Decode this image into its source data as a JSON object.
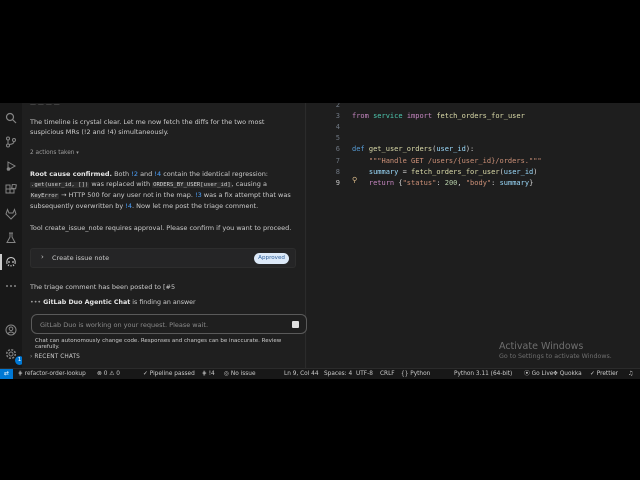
{
  "chat": {
    "top_cut": "— — — —",
    "para1": "The timeline is crystal clear. Let me now fetch the diffs for the two most suspicious MRs (!2 and !4) simultaneously.",
    "actions_taken": "2 actions taken",
    "root_cause": {
      "bold": "Root cause confirmed.",
      "t1": " Both ",
      "l1": "!2",
      "t2": " and ",
      "l2": "!4",
      "t3": " contain the identical regression: ",
      "c1": ".get(user_id, [])",
      "t4": " was replaced with ",
      "c2": "ORDERS_BY_USER[user_id]",
      "t5": ", causing a ",
      "c3": "KeyError",
      "t6": " → HTTP 500 for any user not in the map. ",
      "l3": "!3",
      "t7": " was a fix attempt that was subsequently overwritten by ",
      "l4": "!4",
      "t8": ". Now let me post the triage comment."
    },
    "tool_approval": "Tool create_issue_note requires approval. Please confirm if you want to proceed.",
    "tool_card": {
      "label": "Create issue note",
      "status": "Approved"
    },
    "posted": "The triage comment has been posted to [#5",
    "finding": {
      "bold": "GitLab Duo Agentic Chat",
      "rest": " is finding an answer"
    },
    "input_placeholder": "GitLab Duo is working on your request. Please wait.",
    "disclaimer": "Chat can autonomously change code. Responses and changes can be inaccurate. Review carefully.",
    "recent_chats": "RECENT CHATS"
  },
  "activity_badge": "1",
  "editor": {
    "lines": [
      {
        "n": "2",
        "html": ""
      },
      {
        "n": "3",
        "html": "<span class='kw2'>from</span> <span class='mod'>service</span> <span class='kw2'>import</span> <span class='fn'>fetch_orders_for_user</span>"
      },
      {
        "n": "4",
        "html": ""
      },
      {
        "n": "5",
        "html": ""
      },
      {
        "n": "6",
        "html": "<span class='kw'>def</span> <span class='fn'>get_user_orders</span>(<span class='par'>user_id</span>):"
      },
      {
        "n": "7",
        "html": "    <span class='str'>\"\"\"Handle GET /users/{user_id}/orders.\"\"\"</span>"
      },
      {
        "n": "8",
        "html": "    <span class='par'>summary</span> = <span class='fn'>fetch_orders_for_user</span>(<span class='par'>user_id</span>)"
      },
      {
        "n": "9",
        "html": "    <span class='kw2'>return</span> {<span class='str'>\"status\"</span>: <span class='num'>200</span>, <span class='str'>\"body\"</span>: <span class='par'>summary</span>}"
      }
    ],
    "current_line": "9"
  },
  "watermark": {
    "title": "Activate Windows",
    "sub": "Go to Settings to activate Windows."
  },
  "status": {
    "branch": "refactor-order-lookup",
    "errors": "0",
    "warnings": "0",
    "pipeline": "Pipeline passed",
    "mr": "!4",
    "issue": "No issue",
    "position": "Ln 9, Col 44",
    "spaces": "Spaces: 4",
    "encoding": "UTF-8",
    "eol": "CRLF",
    "language": "Python",
    "interpreter": "Python 3.11 (64-bit)",
    "golive": "Go Live",
    "quokka": "Quokka",
    "prettier": "Prettier"
  }
}
